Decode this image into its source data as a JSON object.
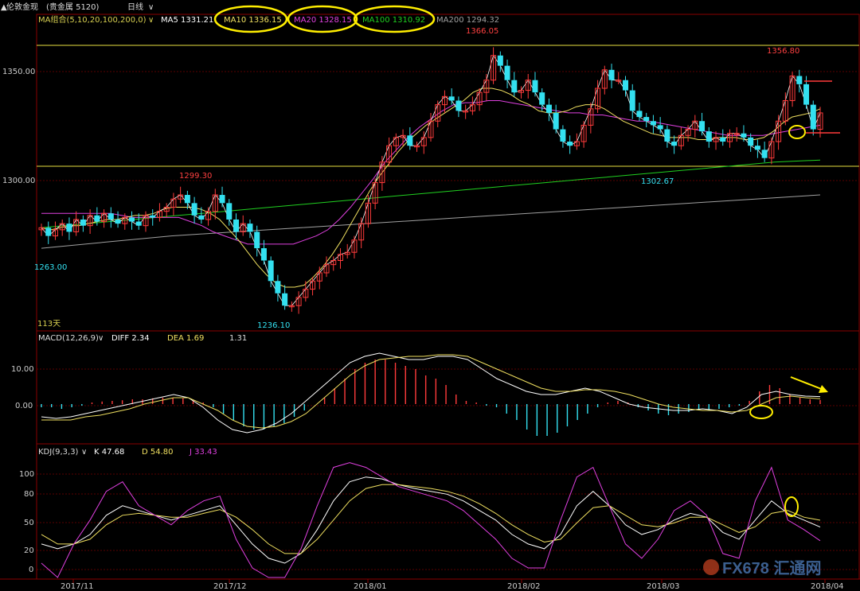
{
  "header": {
    "instrument": "伦敦金现",
    "market": "(贵金属  5120)",
    "period": "日线",
    "period_caret": "∨"
  },
  "main_panel": {
    "indicator_name": "MA组合(5,10,20,100,200,0)",
    "ma5": "MA5 1331.21",
    "ma10": "MA10 1336.15",
    "ma20": "MA20 1328.15",
    "ma100": "MA100 1310.92",
    "ma200": "MA200 1294.32",
    "y_ticks": [
      "1350.00",
      "1300.00"
    ],
    "price_labels": {
      "high": "1366.05",
      "high2": "1356.80",
      "left_high": "1299.30",
      "low": "1236.10",
      "left_low": "1263.00",
      "mid_low": "1302.67"
    },
    "bars_count_label": "113天"
  },
  "macd_panel": {
    "indicator_name": "MACD(12,26,9)",
    "diff": "DIFF  2.34",
    "dea": "DEA  1.69",
    "macd": "1.31",
    "y_ticks": [
      "10.00",
      "0.00"
    ]
  },
  "kdj_panel": {
    "indicator_name": "KDJ(9,3,3)",
    "k": "K  47.68",
    "d": "D  54.80",
    "j": "J  33.43",
    "y_ticks": [
      "100",
      "80",
      "50",
      "20",
      "0"
    ]
  },
  "x_axis": {
    "labels": [
      "2017/11",
      "2017/12",
      "2018/01",
      "2018/02",
      "2018/03",
      "2018/04"
    ]
  },
  "watermark": "FX678 汇通网",
  "colors": {
    "up": "#ff3b3b",
    "down": "#33e0f0",
    "ma5": "#ffffff",
    "ma10": "#f0e060",
    "ma20": "#e040e0",
    "ma100": "#20d020",
    "ma200": "#a0a0a0",
    "highlight": "#ffee00",
    "grid": "#6a0000"
  },
  "chart_data": [
    {
      "type": "candlestick",
      "title": "",
      "ylim": [
        1230,
        1372
      ],
      "x": [
        "2017/11",
        "2017/12",
        "2018/01",
        "2018/02",
        "2018/03",
        "2018/04"
      ],
      "close_path": [
        1278,
        1274,
        1277,
        1280,
        1276,
        1282,
        1279,
        1284,
        1281,
        1285,
        1282,
        1280,
        1283,
        1281,
        1279,
        1284,
        1283,
        1286,
        1288,
        1292,
        1294,
        1290,
        1284,
        1282,
        1286,
        1294,
        1290,
        1282,
        1276,
        1280,
        1276,
        1268,
        1262,
        1252,
        1246,
        1240,
        1240,
        1244,
        1248,
        1252,
        1256,
        1260,
        1262,
        1265,
        1266,
        1272,
        1280,
        1290,
        1300,
        1310,
        1318,
        1322,
        1323,
        1318,
        1318,
        1322,
        1330,
        1338,
        1342,
        1340,
        1335,
        1335,
        1338,
        1344,
        1350,
        1362,
        1357,
        1350,
        1344,
        1345,
        1350,
        1344,
        1338,
        1334,
        1326,
        1320,
        1318,
        1320,
        1328,
        1336,
        1346,
        1355,
        1350,
        1350,
        1345,
        1335,
        1332,
        1330,
        1328,
        1326,
        1320,
        1318,
        1323,
        1326,
        1330,
        1325,
        1320,
        1322,
        1320,
        1324,
        1324,
        1322,
        1318,
        1316,
        1312,
        1320,
        1330,
        1340,
        1352,
        1348,
        1338,
        1326,
        1334
      ],
      "ma10_path": [
        1278,
        1277,
        1278,
        1279,
        1279,
        1280,
        1281,
        1282,
        1282,
        1283,
        1284,
        1284,
        1285,
        1287,
        1288,
        1288,
        1288,
        1287,
        1285,
        1282,
        1277,
        1272,
        1266,
        1260,
        1255,
        1251,
        1249,
        1249,
        1250,
        1254,
        1259,
        1265,
        1272,
        1280,
        1288,
        1296,
        1303,
        1309,
        1315,
        1320,
        1324,
        1328,
        1331,
        1334,
        1337,
        1340,
        1344,
        1346,
        1346,
        1345,
        1343,
        1340,
        1338,
        1335,
        1334,
        1334,
        1335,
        1337,
        1338,
        1338,
        1336,
        1333,
        1330,
        1328,
        1326,
        1324,
        1323,
        1322,
        1322,
        1322,
        1321,
        1321,
        1322,
        1322,
        1322,
        1321,
        1321,
        1322,
        1325,
        1329,
        1332,
        1333,
        1334,
        1336
      ],
      "ma20_path": [
        1285,
        1285,
        1285,
        1285,
        1285,
        1285,
        1285,
        1284,
        1283,
        1283,
        1283,
        1283,
        1283,
        1281,
        1279,
        1276,
        1274,
        1272,
        1270,
        1270,
        1270,
        1270,
        1270,
        1272,
        1274,
        1277,
        1282,
        1288,
        1295,
        1302,
        1310,
        1316,
        1322,
        1327,
        1331,
        1335,
        1338,
        1339,
        1339,
        1340,
        1340,
        1339,
        1338,
        1337,
        1336,
        1335,
        1334,
        1334,
        1333,
        1333,
        1332,
        1331,
        1330,
        1330,
        1329,
        1328,
        1327,
        1326,
        1325,
        1324,
        1323,
        1323,
        1323,
        1323,
        1324,
        1325,
        1326,
        1327,
        1328
      ],
      "ma100_path": [
        1278,
        1280,
        1282,
        1284,
        1286,
        1288,
        1290,
        1292,
        1294,
        1296,
        1298,
        1300,
        1302,
        1304,
        1306,
        1308,
        1310,
        1311
      ],
      "ma200_path": [
        1268,
        1271,
        1274,
        1276,
        1278,
        1280,
        1282,
        1284,
        1286,
        1288,
        1290,
        1292,
        1294
      ]
    },
    {
      "type": "bar",
      "title": "MACD(12,26,9)",
      "ylim": [
        -12,
        19
      ],
      "x": [
        "2017/11",
        "2017/12",
        "2018/01",
        "2018/02",
        "2018/03",
        "2018/04"
      ],
      "histogram": [
        -1,
        -1,
        -1.5,
        -1,
        -0.5,
        0.5,
        0.8,
        1,
        1.2,
        1.5,
        1.5,
        1.8,
        2,
        2,
        1.8,
        1.2,
        0.5,
        -1,
        -3,
        -5,
        -7,
        -8,
        -8,
        -7,
        -6,
        -4,
        -2,
        0,
        2,
        5,
        8,
        11,
        13,
        14,
        14,
        13,
        12,
        11,
        9,
        8,
        6,
        3,
        1,
        0.5,
        -0.5,
        -1,
        -3,
        -5,
        -8,
        -10,
        -10,
        -9,
        -7,
        -5,
        -3,
        -1,
        0.5,
        1,
        0.5,
        -1,
        -2,
        -3,
        -3.5,
        -3,
        -2.5,
        -2,
        -2,
        -1.5,
        -1,
        -0.5,
        1,
        4,
        6,
        5,
        3,
        2,
        1.5,
        1.3
      ],
      "diff": [
        -4,
        -4.5,
        -4,
        -3,
        -2,
        -1,
        0,
        1,
        2,
        3,
        2,
        -1,
        -5,
        -8,
        -9,
        -8,
        -6,
        -3,
        1,
        5,
        9,
        13,
        15,
        16,
        15,
        14,
        14,
        15,
        15,
        14,
        11,
        8,
        6,
        4,
        3,
        3,
        4,
        5,
        4,
        2,
        0,
        -1,
        -1.5,
        -2,
        -2,
        -1.5,
        -2,
        -3,
        -1,
        3,
        4,
        3,
        2.5,
        2.34
      ],
      "dea": [
        -5,
        -5,
        -5,
        -4,
        -3.5,
        -2.5,
        -1.5,
        0,
        1,
        2,
        2,
        0,
        -2,
        -5,
        -7,
        -7.5,
        -7,
        -5.5,
        -3,
        1,
        5,
        9,
        12,
        14,
        14.5,
        15,
        15,
        15.5,
        15.5,
        15,
        13,
        11,
        9,
        7,
        5,
        4,
        4,
        4.5,
        4.5,
        4,
        3,
        1.5,
        0,
        -1,
        -1.5,
        -2,
        -2,
        -2.5,
        -2,
        0,
        2,
        2.5,
        2,
        1.69
      ]
    },
    {
      "type": "line",
      "title": "KDJ(9,3,3)",
      "ylim": [
        -5,
        118
      ],
      "x": [
        "2017/11",
        "2017/12",
        "2018/01",
        "2018/02",
        "2018/03",
        "2018/04"
      ],
      "series": [
        {
          "name": "K",
          "values": [
            30,
            25,
            30,
            40,
            60,
            70,
            65,
            60,
            55,
            60,
            65,
            70,
            50,
            30,
            15,
            10,
            20,
            45,
            75,
            95,
            100,
            98,
            92,
            88,
            85,
            82,
            75,
            65,
            55,
            40,
            30,
            25,
            40,
            70,
            85,
            70,
            50,
            40,
            45,
            55,
            62,
            58,
            42,
            35,
            55,
            75,
            62,
            55,
            47.68
          ]
        },
        {
          "name": "D",
          "values": [
            40,
            30,
            30,
            35,
            50,
            60,
            62,
            60,
            58,
            58,
            62,
            66,
            58,
            45,
            30,
            20,
            20,
            35,
            55,
            75,
            88,
            92,
            92,
            90,
            88,
            85,
            80,
            72,
            62,
            50,
            40,
            32,
            35,
            52,
            68,
            70,
            60,
            50,
            48,
            52,
            58,
            58,
            50,
            42,
            48,
            62,
            65,
            58,
            54.8
          ]
        },
        {
          "name": "J",
          "values": [
            10,
            -5,
            30,
            55,
            85,
            95,
            70,
            60,
            50,
            65,
            75,
            80,
            35,
            5,
            -5,
            -5,
            25,
            70,
            110,
            115,
            110,
            100,
            90,
            85,
            80,
            75,
            65,
            50,
            35,
            15,
            5,
            5,
            55,
            100,
            110,
            70,
            30,
            15,
            35,
            65,
            75,
            60,
            20,
            15,
            75,
            110,
            55,
            45,
            33.43
          ]
        }
      ]
    }
  ]
}
